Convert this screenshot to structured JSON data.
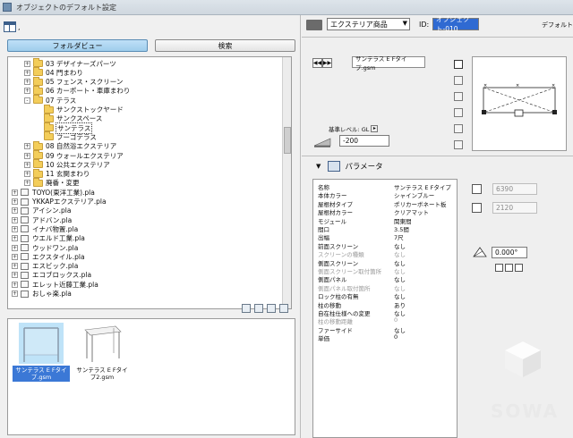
{
  "window": {
    "title": "オブジェクトのデフォルト設定"
  },
  "left": {
    "view_dropdown": ",",
    "tabs": [
      {
        "label": "フォルダビュー",
        "active": true
      },
      {
        "label": "検索",
        "active": false
      }
    ],
    "tree": [
      {
        "label": "03 デザイナーズパーツ",
        "level": 2,
        "kind": "folder",
        "pm": "+"
      },
      {
        "label": "04 門まわり",
        "level": 2,
        "kind": "folder",
        "pm": "+"
      },
      {
        "label": "05 フェンス・スクリーン",
        "level": 2,
        "kind": "folder",
        "pm": "+"
      },
      {
        "label": "06 カーポート・車庫まわり",
        "level": 2,
        "kind": "folder",
        "pm": "+"
      },
      {
        "label": "07 テラス",
        "level": 2,
        "kind": "folder",
        "pm": "-"
      },
      {
        "label": "サンクストックヤード",
        "level": 3,
        "kind": "folder",
        "pm": ""
      },
      {
        "label": "サンクスペース",
        "level": 3,
        "kind": "folder",
        "pm": ""
      },
      {
        "label": "サンテラス",
        "level": 3,
        "kind": "folder",
        "pm": "",
        "selected": true
      },
      {
        "label": "フーゴテラス",
        "level": 3,
        "kind": "folder",
        "pm": ""
      },
      {
        "label": "08 自然浴エクステリア",
        "level": 2,
        "kind": "folder",
        "pm": "+"
      },
      {
        "label": "09 ウォールエクステリア",
        "level": 2,
        "kind": "folder",
        "pm": "+"
      },
      {
        "label": "10 公共エクステリア",
        "level": 2,
        "kind": "folder",
        "pm": "+"
      },
      {
        "label": "11 玄関まわり",
        "level": 2,
        "kind": "folder",
        "pm": "+"
      },
      {
        "label": "廃番・変更",
        "level": 2,
        "kind": "folder",
        "pm": "+"
      },
      {
        "label": "TOYO(東洋工業).pla",
        "level": 1,
        "kind": "file",
        "pm": "+"
      },
      {
        "label": "YKKAPエクステリア.pla",
        "level": 1,
        "kind": "file",
        "pm": "+"
      },
      {
        "label": "アイシン.pla",
        "level": 1,
        "kind": "file",
        "pm": "+"
      },
      {
        "label": "アドバン.pla",
        "level": 1,
        "kind": "file",
        "pm": "+"
      },
      {
        "label": "イナバ物置.pla",
        "level": 1,
        "kind": "file",
        "pm": "+"
      },
      {
        "label": "ウエルド工業.pla",
        "level": 1,
        "kind": "file",
        "pm": "+"
      },
      {
        "label": "ウッドワン.pla",
        "level": 1,
        "kind": "file",
        "pm": "+"
      },
      {
        "label": "エクスタイル.pla",
        "level": 1,
        "kind": "file",
        "pm": "+"
      },
      {
        "label": "エスビック.pla",
        "level": 1,
        "kind": "file",
        "pm": "+"
      },
      {
        "label": "エコブロックス.pla",
        "level": 1,
        "kind": "file",
        "pm": "+"
      },
      {
        "label": "エレット近藤工業.pla",
        "level": 1,
        "kind": "file",
        "pm": "+"
      },
      {
        "label": "おしゃ楽.pla",
        "level": 1,
        "kind": "file",
        "pm": "+"
      }
    ],
    "previews": [
      {
        "label": "サンテラス E Fタイプ.gsm",
        "selected": true
      },
      {
        "label": "サンテラス E Fタイプ2.gsm",
        "selected": false
      }
    ]
  },
  "right": {
    "object_type": "エクステリア商品",
    "id_label": "ID:",
    "id_value": "オブジェクト-010",
    "default_label": "デフォルト",
    "library_part_name": "サンテラス E Fタイプ.gsm",
    "level_label": "基準レベル: GL",
    "level_value": "-200",
    "section_title": "パラメータ",
    "width_value": "6390",
    "depth_value": "2120",
    "angle_value": "0.000°",
    "params": [
      {
        "name": "名称",
        "value": "サンテラス E Fタイプ",
        "dim": false
      },
      {
        "name": "本体カラー",
        "value": "シャインブルー",
        "dim": false
      },
      {
        "name": "屋根材タイプ",
        "value": "ポリカーボネート板",
        "dim": false
      },
      {
        "name": "屋根材カラー",
        "value": "クリアマット",
        "dim": false
      },
      {
        "name": "モジュール",
        "value": "関東間",
        "dim": false
      },
      {
        "name": "間口",
        "value": "3.5間",
        "dim": false
      },
      {
        "name": "出幅",
        "value": "7尺",
        "dim": false
      },
      {
        "name": "前面スクリーン",
        "value": "なし",
        "dim": false
      },
      {
        "name": "スクリーンの種類",
        "value": "なし",
        "dim": true
      },
      {
        "name": "側面スクリーン",
        "value": "なし",
        "dim": false
      },
      {
        "name": "側面スクリーン取付箇所",
        "value": "なし",
        "dim": true
      },
      {
        "name": "側面パネル",
        "value": "なし",
        "dim": false
      },
      {
        "name": "側面パネル取付箇所",
        "value": "なし",
        "dim": true
      },
      {
        "name": "ロック柱の有無",
        "value": "なし",
        "dim": false
      },
      {
        "name": "柱の移動",
        "value": "あり",
        "dim": false
      },
      {
        "name": "自在柱仕様への変更",
        "value": "なし",
        "dim": false
      },
      {
        "name": "柱の移動距離",
        "value": "0",
        "dim": true
      },
      {
        "name": "ファーサイド",
        "value": "なし",
        "dim": false
      },
      {
        "name": "単価",
        "value": "0",
        "dim": false
      }
    ]
  },
  "watermark": "SOWA"
}
